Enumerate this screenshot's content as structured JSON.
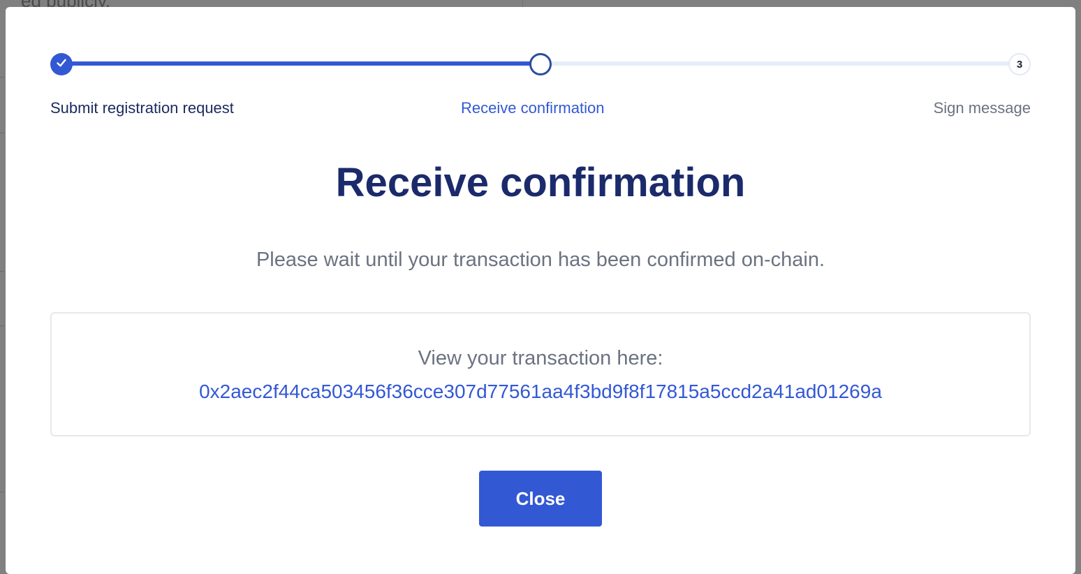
{
  "background": {
    "fragment_text": "ed publicly."
  },
  "stepper": {
    "progress_percent": 50,
    "steps": [
      {
        "label": "Submit registration request",
        "state": "complete",
        "marker": ""
      },
      {
        "label": "Receive confirmation",
        "state": "current",
        "marker": ""
      },
      {
        "label": "Sign message",
        "state": "upcoming",
        "marker": "3"
      }
    ]
  },
  "main": {
    "title": "Receive confirmation",
    "subtitle": "Please wait until your transaction has been confirmed on-chain."
  },
  "transaction": {
    "label": "View your transaction here:",
    "hash": "0x2aec2f44ca503456f36cce307d77561aa4f3bd9f8f17815a5ccd2a41ad01269a"
  },
  "actions": {
    "close_label": "Close"
  },
  "colors": {
    "accent": "#3358d4",
    "title": "#1b2a6b",
    "muted": "#6b7280"
  },
  "icons": {
    "step_complete": "checkmark-icon"
  }
}
